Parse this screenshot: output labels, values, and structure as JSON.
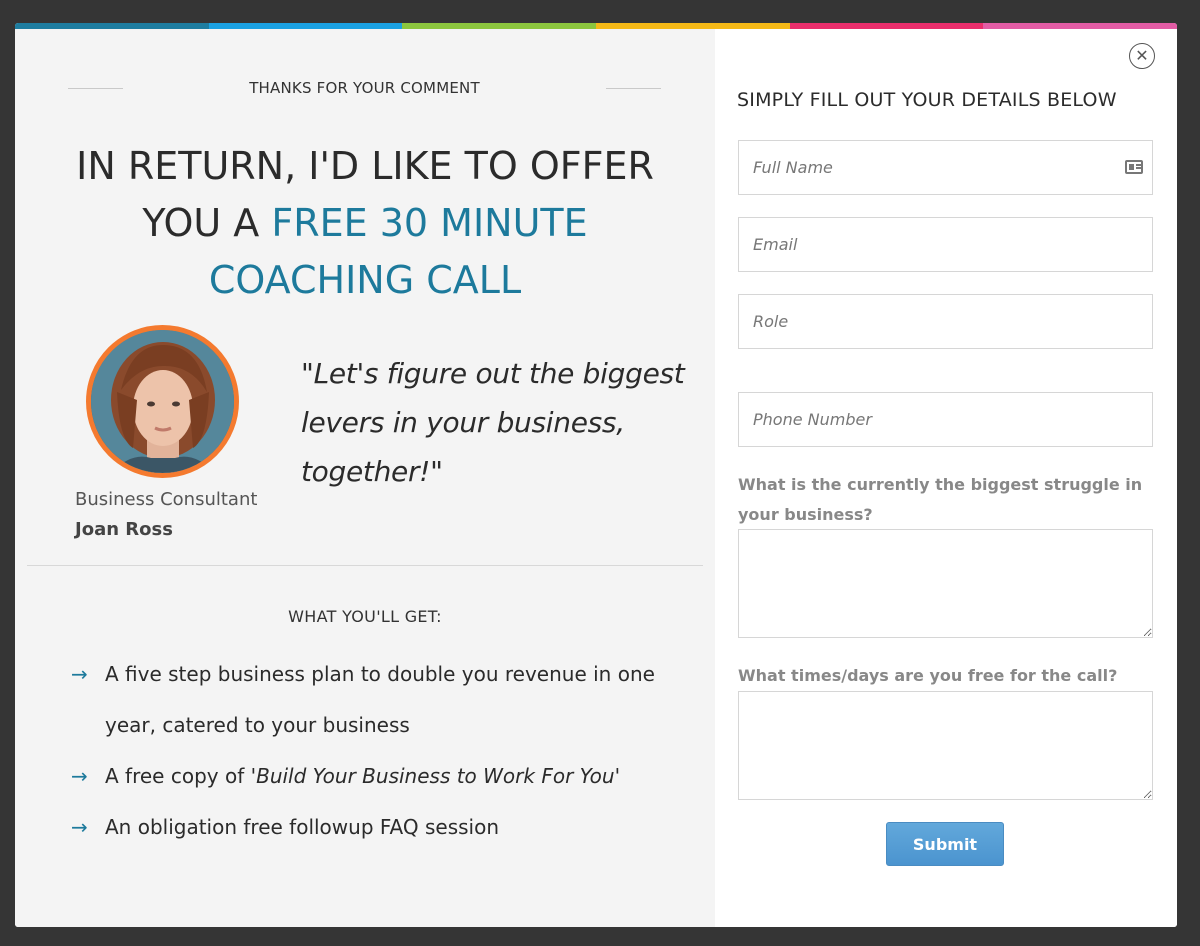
{
  "colors": {
    "strip": [
      "#1e7da0",
      "#1ba1e2",
      "#8cc63e",
      "#f5b917",
      "#ea2e6c",
      "#e35ca5"
    ],
    "accent": "#1d7a9c",
    "avatar_ring": "#f47a2f",
    "submit": "#4b94cf"
  },
  "left": {
    "thanks": "THANKS FOR YOUR COMMENT",
    "headline_part1": "IN RETURN, I'D LIKE TO OFFER YOU A ",
    "headline_accent": "FREE 30 MINUTE COACHING CALL",
    "quote": "\"Let's figure out the biggest levers in your business, together!\"",
    "role": "Business Consultant",
    "name": "Joan Ross",
    "get_title": "WHAT YOU'LL GET:",
    "benefits": [
      {
        "text": "A five step business plan to double you revenue in one year, catered to your business"
      },
      {
        "pre": "A free copy of '",
        "em": "Build Your Business to Work For You",
        "post": "'"
      },
      {
        "text": "An obligation free followup FAQ session"
      }
    ]
  },
  "form": {
    "title": "SIMPLY FILL OUT YOUR DETAILS BELOW",
    "full_name_placeholder": "Full Name",
    "email_placeholder": "Email",
    "role_placeholder": "Role",
    "phone_placeholder": "Phone Number",
    "struggle_label": "What is the currently the biggest struggle in your business?",
    "times_label": "What times/days are you free for the call?",
    "submit_label": "Submit",
    "close_glyph": "✕"
  },
  "icons": {
    "close": "close-icon",
    "arrow": "arrow-right-icon",
    "contact_card": "contact-card-icon"
  }
}
